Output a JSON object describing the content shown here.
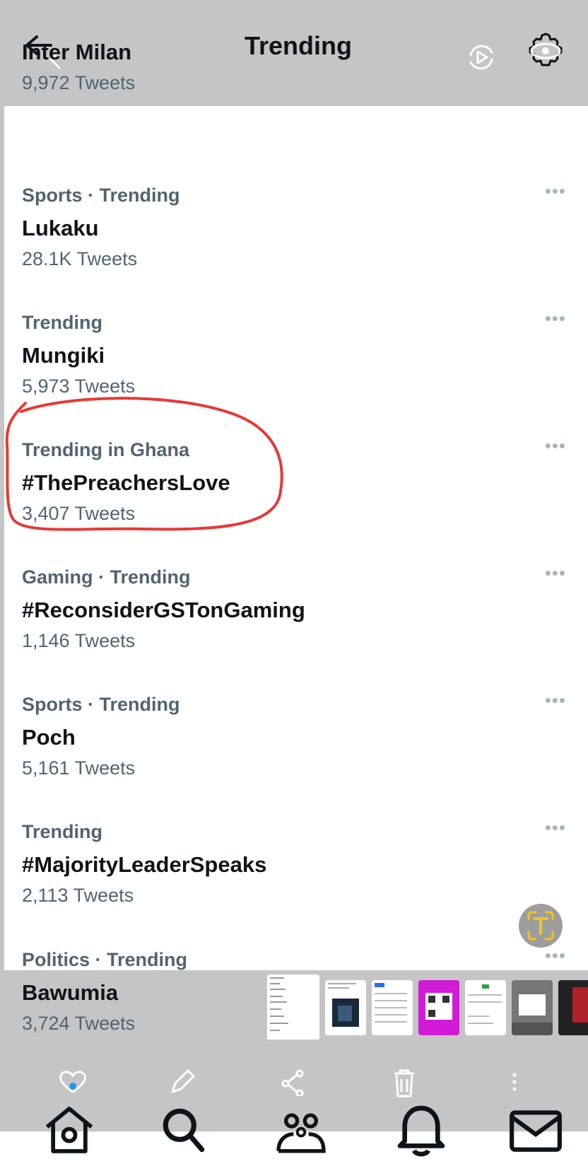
{
  "header": {
    "title": "Trending",
    "back_icon": "back-arrow-icon",
    "actions": [
      "screen-record-icon",
      "settings-eye-icon"
    ]
  },
  "trends": [
    {
      "category": "",
      "name": "Inter Milan",
      "count": "9,972 Tweets"
    },
    {
      "category": "Sports · Trending",
      "name": "Lukaku",
      "count": "28.1K Tweets"
    },
    {
      "category": "Trending",
      "name": "Mungiki",
      "count": "5,973 Tweets"
    },
    {
      "category": "Trending in Ghana",
      "name": "#ThePreachersLove",
      "count": "3,407 Tweets"
    },
    {
      "category": "Gaming · Trending",
      "name": "#ReconsiderGSTonGaming",
      "count": "1,146 Tweets"
    },
    {
      "category": "Sports · Trending",
      "name": "Poch",
      "count": "5,161 Tweets"
    },
    {
      "category": "Trending",
      "name": "#MajorityLeaderSpeaks",
      "count": "2,113 Tweets"
    },
    {
      "category": "Politics · Trending",
      "name": "Bawumia",
      "count": "3,724 Tweets"
    }
  ],
  "more_glyph": "•••",
  "bottom_nav": [
    "home-icon",
    "search-icon",
    "communities-icon",
    "notifications-icon",
    "messages-icon"
  ],
  "overlay_actions": [
    "favorite-icon",
    "edit-icon",
    "share-icon",
    "delete-icon",
    "more-vertical-icon"
  ],
  "colors": {
    "annotation": "#e53935",
    "secondary_text": "#536471",
    "primary_text": "#0f1419",
    "fab_icon": "#f5c518"
  }
}
